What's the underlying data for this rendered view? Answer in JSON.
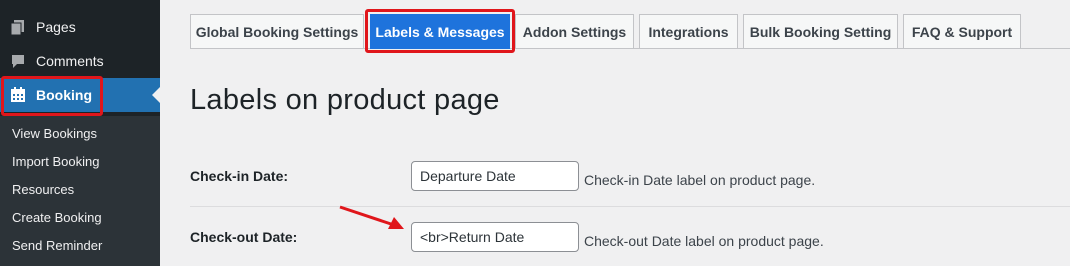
{
  "sidebar": {
    "items": [
      {
        "label": "Pages",
        "icon": "pages-icon"
      },
      {
        "label": "Comments",
        "icon": "comments-icon"
      },
      {
        "label": "Booking",
        "icon": "calendar-icon",
        "active": true
      }
    ],
    "submenu": [
      "View Bookings",
      "Import Booking",
      "Resources",
      "Create Booking",
      "Send Reminder"
    ]
  },
  "tabs": [
    {
      "label": "Global Booking Settings"
    },
    {
      "label": "Labels & Messages",
      "active": true
    },
    {
      "label": "Addon Settings"
    },
    {
      "label": "Integrations"
    },
    {
      "label": "Bulk Booking Setting"
    },
    {
      "label": "FAQ & Support"
    }
  ],
  "page_heading": "Labels on product page",
  "fields": [
    {
      "label": "Check-in Date:",
      "value": "Departure Date",
      "description": "Check-in Date label on product page."
    },
    {
      "label": "Check-out Date:",
      "value": "<br>Return Date",
      "description": "Check-out Date label on product page."
    }
  ],
  "colors": {
    "sidebar_bg": "#1d2327",
    "submenu_bg": "#2c3338",
    "active_menu": "#2271b1",
    "active_tab": "#1e73dc",
    "highlight": "#e0161b"
  }
}
